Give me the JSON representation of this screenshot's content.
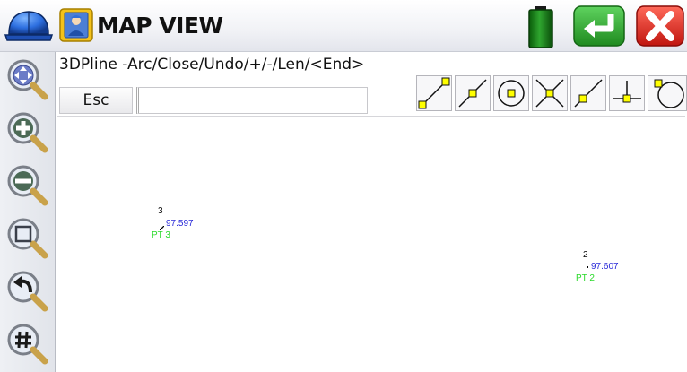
{
  "title": "MAP VIEW",
  "command": {
    "prompt": "3DPline -Arc/Close/Undo/+/-/Len/<End>",
    "esc_label": "Esc",
    "input_value": ""
  },
  "header_icons": [
    "helmet-icon",
    "app-logo-icon",
    "battery-icon",
    "enter-icon",
    "close-icon"
  ],
  "left_toolbar": [
    "pan-icon",
    "zoom-in-icon",
    "zoom-out-icon",
    "zoom-window-icon",
    "zoom-previous-icon",
    "grid-icon"
  ],
  "snap_tools": [
    "snap-endpoint-icon",
    "snap-midpoint-icon",
    "snap-center-icon",
    "snap-intersection-icon",
    "snap-nearest-icon",
    "snap-perpendicular-icon",
    "snap-tangent-icon"
  ],
  "points": [
    {
      "number": "3",
      "elevation": "97.597",
      "description": "PT 3"
    },
    {
      "number": "2",
      "elevation": "97.607",
      "description": "PT 2"
    }
  ],
  "colors": {
    "point_number": "#000000",
    "elevation": "#2b2bd9",
    "description": "#2bd92b",
    "snap_marker": "#ffff00",
    "enter_button": "#2e9e2e",
    "close_button": "#d81e1e"
  }
}
